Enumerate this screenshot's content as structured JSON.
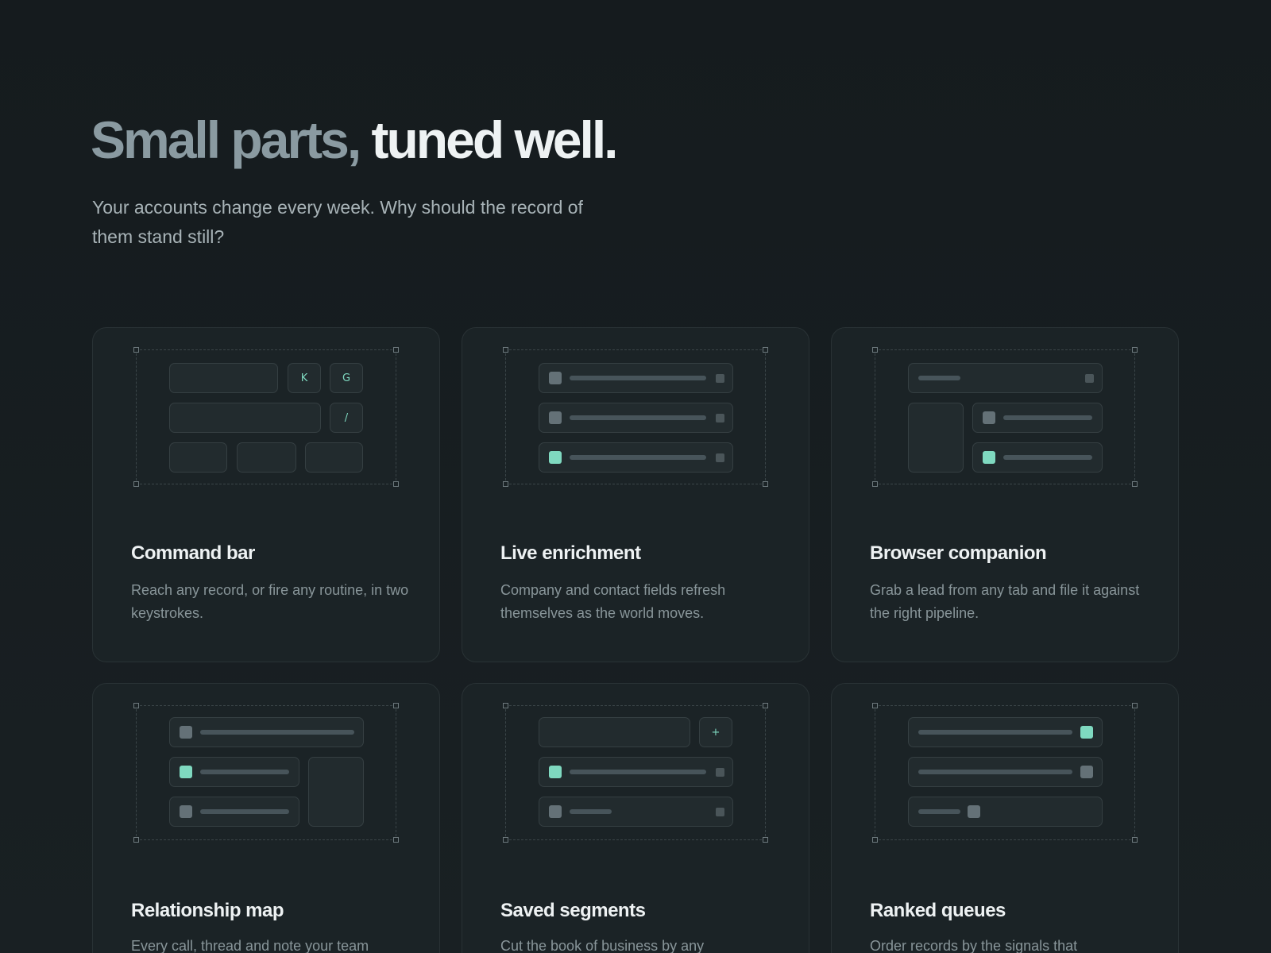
{
  "hero": {
    "title_muted": "Small parts,",
    "title_bright": "tuned well.",
    "subtitle": "Your accounts change every week. Why should the record of them stand still?"
  },
  "colors": {
    "background": "#161c1f",
    "accent": "#7fd9c0",
    "card": "#1b2326"
  },
  "cards": [
    {
      "title": "Command bar",
      "desc": "Reach any record, or fire any routine, in two keystrokes.",
      "keys": [
        "K",
        "G",
        "/"
      ]
    },
    {
      "title": "Live enrichment",
      "desc": "Company and contact fields refresh themselves as the world moves."
    },
    {
      "title": "Browser companion",
      "desc": "Grab a lead from any tab and file it against the right pipeline."
    },
    {
      "title": "Relationship map",
      "desc": "Every call, thread and note your team"
    },
    {
      "title": "Saved segments",
      "desc": "Cut the book of business by any",
      "add_key": "+"
    },
    {
      "title": "Ranked queues",
      "desc": "Order records by the signals that"
    }
  ]
}
